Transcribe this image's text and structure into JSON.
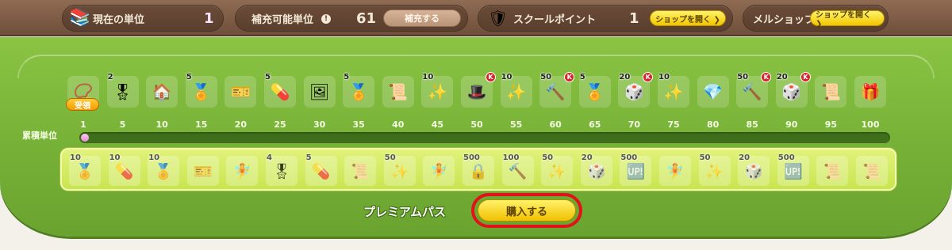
{
  "header": {
    "current_units_label": "現在の単位",
    "current_units_value": "1",
    "refill_label": "補充可能単位",
    "refill_value": "61",
    "refill_button": "補充する",
    "school_points_label": "スクールポイント",
    "school_points_value": "1",
    "open_shop_button": "ショップを開く ❯",
    "meru_shop_label": "メルショップ",
    "meru_open_shop_button": "ショップを開く ❯"
  },
  "track": {
    "accum_label": "累積単位",
    "received_badge": "受領",
    "progress_fraction": 0.01,
    "ticks": [
      "1",
      "5",
      "10",
      "15",
      "20",
      "25",
      "30",
      "35",
      "40",
      "45",
      "50",
      "55",
      "60",
      "65",
      "70",
      "75",
      "80",
      "85",
      "90",
      "95",
      "100"
    ],
    "free_rewards": [
      {
        "icon": "gem-necklace-icon",
        "glyph": "📿",
        "qty": "",
        "k": false
      },
      {
        "icon": "gold-medal-icon",
        "glyph": "🎖",
        "qty": "2",
        "k": false
      },
      {
        "icon": "house-icon",
        "glyph": "🏠",
        "qty": "",
        "k": false
      },
      {
        "icon": "gold-emblem-icon",
        "glyph": "🏅",
        "qty": "5",
        "k": false
      },
      {
        "icon": "ticket-icon",
        "glyph": "🎫",
        "qty": "",
        "k": false
      },
      {
        "icon": "red-capsule-icon",
        "glyph": "💊",
        "qty": "5",
        "k": false
      },
      {
        "icon": "card-icon",
        "glyph": "🖼",
        "qty": "",
        "k": false
      },
      {
        "icon": "gold-emblem-icon",
        "glyph": "🏅",
        "qty": "5",
        "k": false
      },
      {
        "icon": "scroll-icon",
        "glyph": "📜",
        "qty": "",
        "k": false
      },
      {
        "icon": "star-fragment-icon",
        "glyph": "✨",
        "qty": "10",
        "k": false
      },
      {
        "icon": "black-hat-icon",
        "glyph": "🎩",
        "qty": "",
        "k": true
      },
      {
        "icon": "star-fragment-icon",
        "glyph": "✨",
        "qty": "10",
        "k": false
      },
      {
        "icon": "hammer-icon",
        "glyph": "🔨",
        "qty": "50",
        "k": true
      },
      {
        "icon": "gold-emblem-icon",
        "glyph": "🏅",
        "qty": "5",
        "k": false
      },
      {
        "icon": "purple-cube-icon",
        "glyph": "🎲",
        "qty": "20",
        "k": true
      },
      {
        "icon": "star-fragment-icon",
        "glyph": "✨",
        "qty": "10",
        "k": false
      },
      {
        "icon": "crystal-icon",
        "glyph": "💎",
        "qty": "",
        "k": false
      },
      {
        "icon": "hammer-icon",
        "glyph": "🔨",
        "qty": "50",
        "k": true
      },
      {
        "icon": "green-cube-icon",
        "glyph": "🎲",
        "qty": "20",
        "k": true
      },
      {
        "icon": "scroll-icon",
        "glyph": "📜",
        "qty": "",
        "k": false
      },
      {
        "icon": "gift-box-icon",
        "glyph": "🎁",
        "qty": "",
        "k": false
      }
    ]
  },
  "premium": {
    "label": "プレミアムパス",
    "buy_button": "購入する",
    "rewards": [
      {
        "icon": "gold-emblem-icon",
        "glyph": "🏅",
        "qty": "10"
      },
      {
        "icon": "red-capsule-icon",
        "glyph": "💊",
        "qty": "10"
      },
      {
        "icon": "gold-emblem-icon",
        "glyph": "🏅",
        "qty": "10"
      },
      {
        "icon": "ticket-icon",
        "glyph": "🎫",
        "qty": ""
      },
      {
        "icon": "fairy-icon",
        "glyph": "🧚",
        "qty": ""
      },
      {
        "icon": "gold-medal-icon",
        "glyph": "🎖",
        "qty": "4"
      },
      {
        "icon": "red-capsule-icon",
        "glyph": "💊",
        "qty": "5"
      },
      {
        "icon": "scroll-icon",
        "glyph": "📜",
        "qty": ""
      },
      {
        "icon": "star-fragment-icon",
        "glyph": "✨",
        "qty": "50"
      },
      {
        "icon": "fairy-icon",
        "glyph": "🧚",
        "qty": ""
      },
      {
        "icon": "lock-icon",
        "glyph": "🔒",
        "qty": "500"
      },
      {
        "icon": "hammer-icon",
        "glyph": "🔨",
        "qty": "100"
      },
      {
        "icon": "star-fragment-icon",
        "glyph": "✨",
        "qty": "50"
      },
      {
        "icon": "purple-cube-icon",
        "glyph": "🎲",
        "qty": "20"
      },
      {
        "icon": "exp-icon",
        "glyph": "🆙",
        "qty": "500"
      },
      {
        "icon": "fairy-icon",
        "glyph": "🧚",
        "qty": ""
      },
      {
        "icon": "star-fragment-icon",
        "glyph": "✨",
        "qty": "50"
      },
      {
        "icon": "green-cube-icon",
        "glyph": "🎲",
        "qty": "20"
      },
      {
        "icon": "exp-icon",
        "glyph": "🆙",
        "qty": "500"
      },
      {
        "icon": "scroll-icon",
        "glyph": "📜",
        "qty": ""
      },
      {
        "icon": "scroll-icon",
        "glyph": "📜",
        "qty": ""
      }
    ]
  },
  "colors": {
    "topbar": "#7d5c45",
    "field_green": "#80ba3d",
    "buy_highlight": "#e4101a",
    "progress_fill": "#e58bd9"
  }
}
